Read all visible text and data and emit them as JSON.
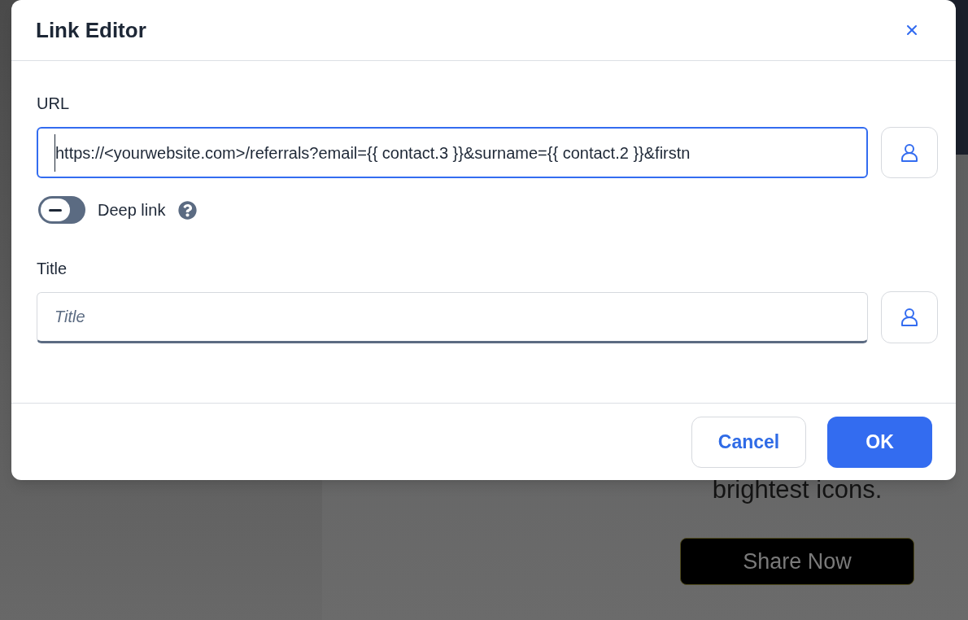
{
  "dialog": {
    "title": "Link Editor",
    "url": {
      "label": "URL",
      "value": "https://<yourwebsite.com>/referrals?email={{ contact.3 }}&surname={{ contact.2 }}&firstn",
      "focused": true
    },
    "deep_link": {
      "label": "Deep link",
      "on": false
    },
    "title_field": {
      "label": "Title",
      "placeholder": "Title",
      "focused": false
    },
    "buttons": [
      {
        "label": "Cancel",
        "kind": "secondary"
      },
      {
        "label": "OK",
        "kind": "primary"
      }
    ]
  },
  "background": {
    "tagline": "brightest icons.",
    "share_button": "Share Now"
  }
}
